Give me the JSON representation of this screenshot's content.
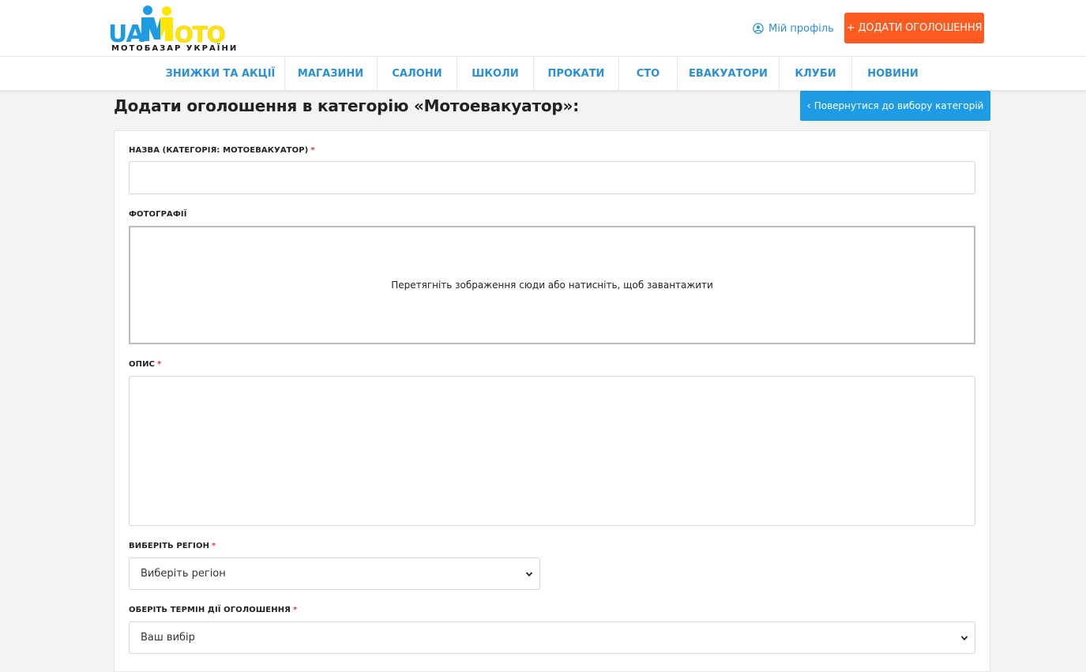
{
  "header": {
    "logo_sub": "МОТОБАЗАР УКРАЇНИ",
    "profile_label": "Мій профіль",
    "add_button_label": "+ ДОДАТИ ОГОЛОШЕННЯ"
  },
  "nav": {
    "items": [
      "ЗНИЖКИ ТА АКЦІЇ",
      "МАГАЗИНИ",
      "САЛОНИ",
      "ШКОЛИ",
      "ПРОКАТИ",
      "СТО",
      "ЕВАКУАТОРИ",
      "КЛУБИ",
      "НОВИНИ"
    ]
  },
  "page": {
    "title": "Додати оголошення в категорію «Мотоевакуатор»:",
    "back_button_label": "Повернутися до вибору категорій"
  },
  "form": {
    "name_label": "НАЗВА (КАТЕГОРІЯ: МОТОЕВАКУАТОР)",
    "name_value": "",
    "photos_label": "ФОТОГРАФІЇ",
    "dropzone_text": "Перетягніть зображення сюди або натисніть, щоб завантажити",
    "description_label": "ОПИС",
    "region_label": "ВИБЕРІТЬ РЕГІОН",
    "region_selected": "Виберіть регіон",
    "term_label": "ОБЕРІТЬ ТЕРМІН ДІЇ ОГОЛОШЕННЯ",
    "term_selected": "Ваш вибір",
    "required_mark": "*"
  },
  "colors": {
    "accent_blue": "#1e9be5",
    "accent_orange": "#ff5a1f",
    "logo_yellow": "#ffe500",
    "link_blue": "#2a8fd4",
    "required_red": "#e23b3b"
  },
  "icons": {
    "profile": "user-circle-icon",
    "back": "chevron-left-icon",
    "select": "chevron-down-icon"
  }
}
